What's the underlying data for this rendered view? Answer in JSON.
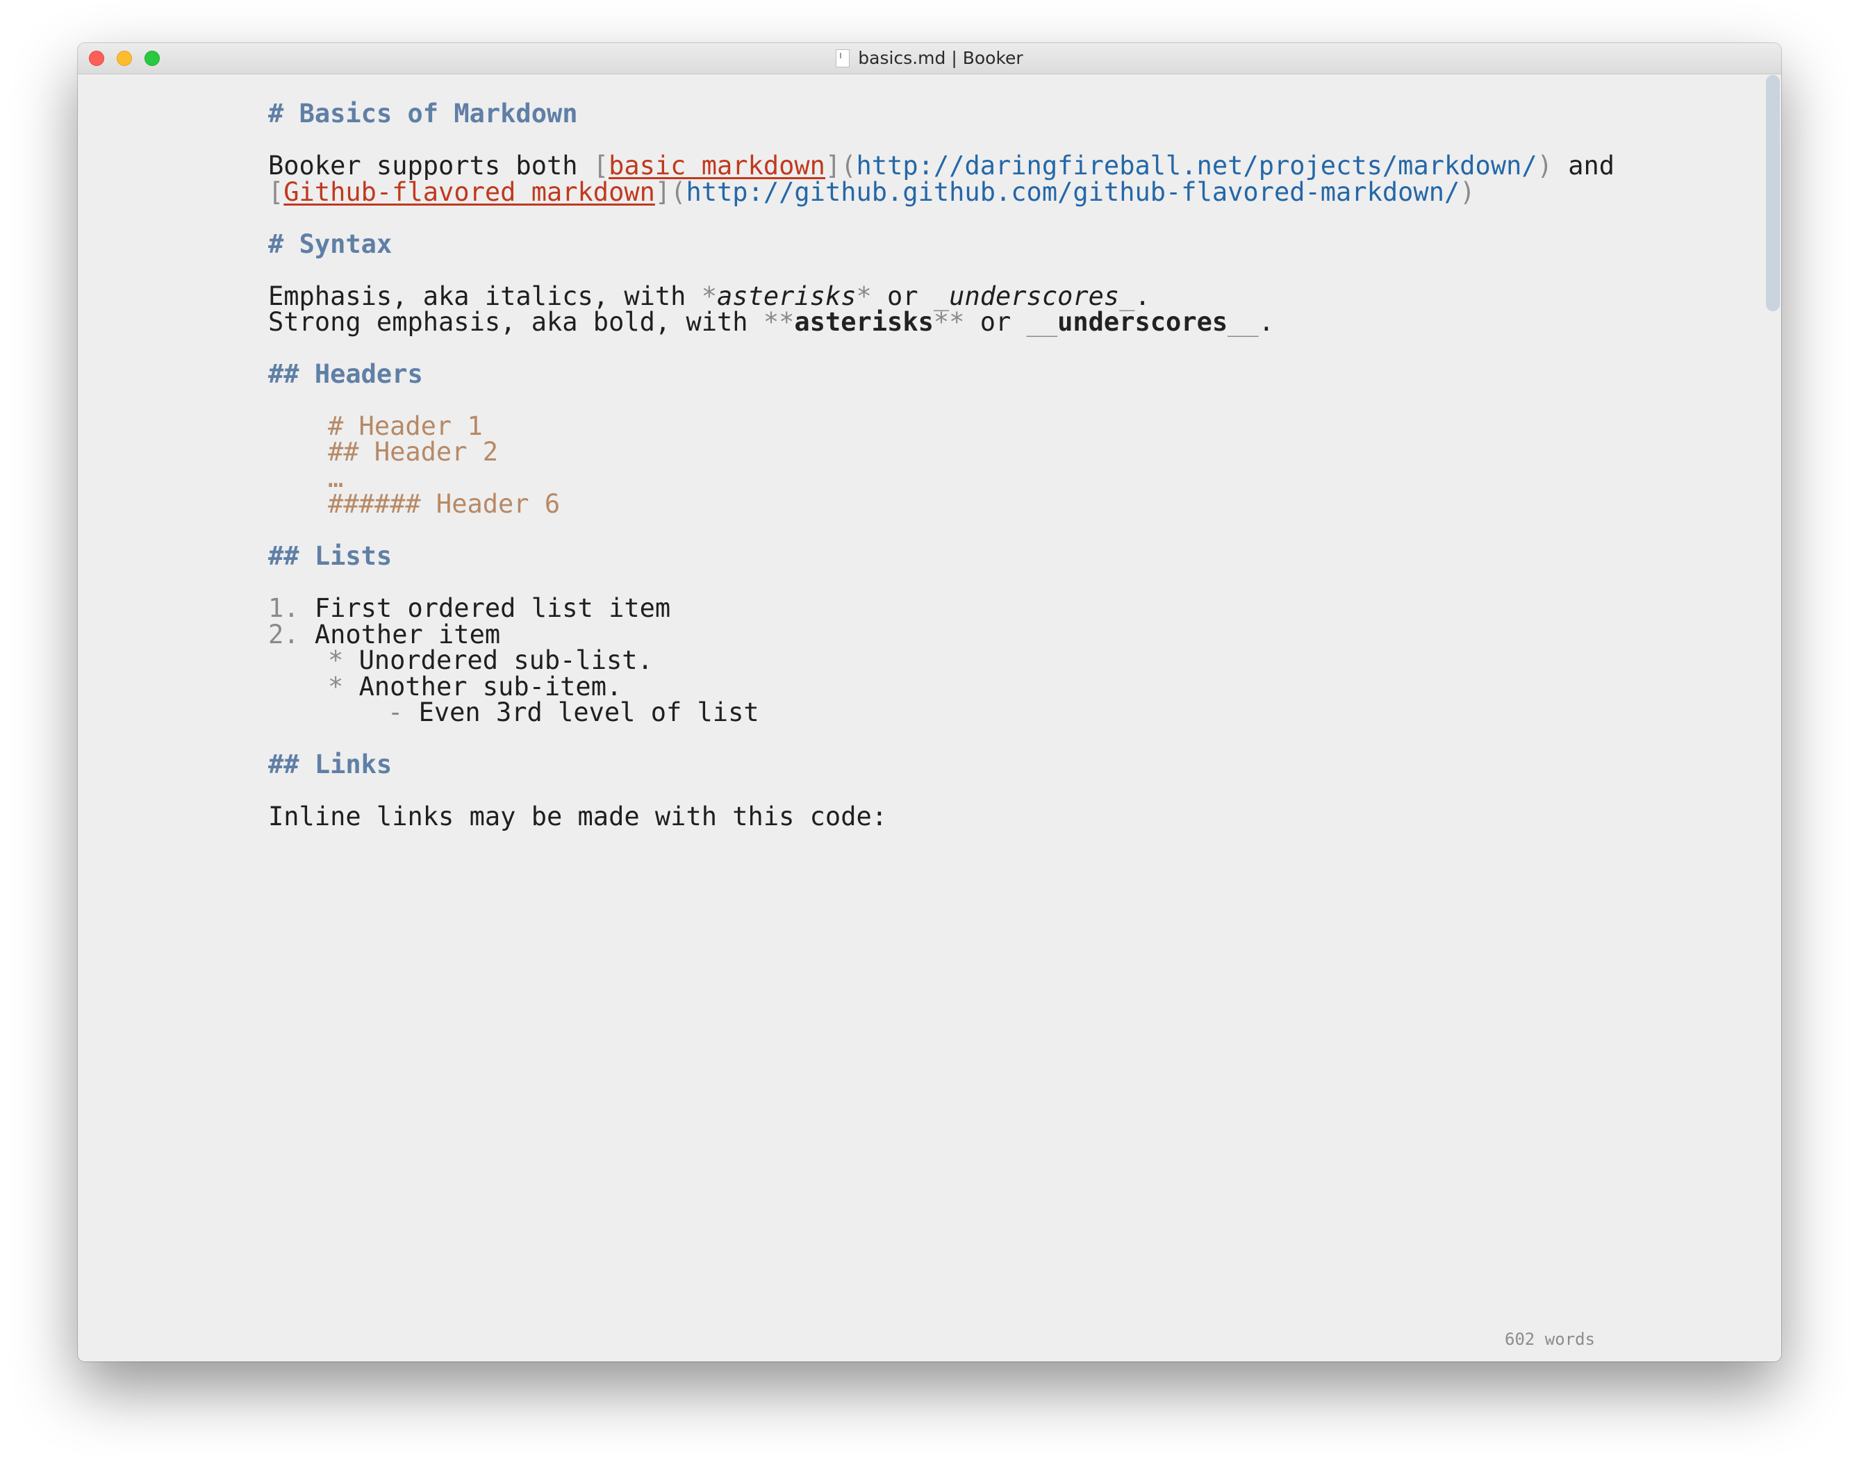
{
  "window": {
    "title": "basics.md | Booker",
    "controls": [
      "close",
      "minimize",
      "zoom"
    ]
  },
  "status": {
    "word_count": "602 words"
  },
  "document": {
    "h1_basics": {
      "marker": "# ",
      "text": "Basics of Markdown"
    },
    "intro": {
      "prefix": "Booker supports both ",
      "link1": {
        "open": "[",
        "text": "basic markdown",
        "mid": "](",
        "url": "http://daringfireball.net/projects/markdown/",
        "close": ")"
      },
      "joiner": " and",
      "link2": {
        "open": "[",
        "text": "Github-flavored markdown",
        "mid": "](",
        "url": "http://github.github.com/github-flavored-markdown/",
        "close": ")"
      }
    },
    "h1_syntax": {
      "marker": "# ",
      "text": "Syntax"
    },
    "emphasis": {
      "prefix": "Emphasis, aka italics, with ",
      "m1": "*",
      "w1": "asterisks",
      "m2": "*",
      "or": " or ",
      "m3": "_",
      "w2": "underscores",
      "m4": "_",
      "end": "."
    },
    "strong": {
      "prefix": "Strong emphasis, aka bold, with ",
      "m1": "**",
      "w1": "asterisks",
      "m2": "**",
      "or": " or ",
      "m3": "__",
      "w2": "underscores",
      "m4": "__",
      "end": "."
    },
    "h2_headers": {
      "marker": "## ",
      "text": "Headers"
    },
    "code_lines": [
      "# Header 1",
      "## Header 2",
      "…",
      "###### Header 6"
    ],
    "h2_lists": {
      "marker": "## ",
      "text": "Lists"
    },
    "list": {
      "item1": {
        "marker": "1. ",
        "text": "First ordered list item"
      },
      "item2": {
        "marker": "2. ",
        "text": "Another item"
      },
      "sub1": {
        "marker": "* ",
        "text": "Unordered sub-list."
      },
      "sub2": {
        "marker": "* ",
        "text": "Another sub-item."
      },
      "sub3": {
        "marker": "- ",
        "text": "Even 3rd level of list"
      }
    },
    "h2_links": {
      "marker": "## ",
      "text": "Links"
    },
    "links_intro": "Inline links may be made with this code:"
  }
}
